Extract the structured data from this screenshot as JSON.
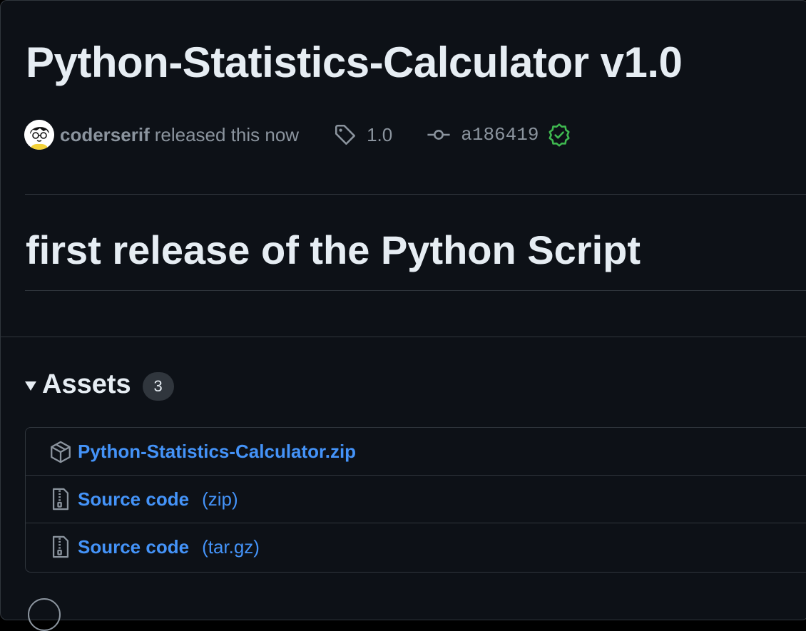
{
  "release": {
    "title": "Python-Statistics-Calculator v1.0",
    "author": "coderserif",
    "released_text": "released this now",
    "tag": "1.0",
    "commit": "a186419",
    "body_heading": "first release of the Python Script"
  },
  "assets": {
    "title": "Assets",
    "count": "3",
    "items": [
      {
        "name": "Python-Statistics-Calculator.zip",
        "suffix": "",
        "icon": "package-icon"
      },
      {
        "name": "Source code",
        "suffix": "(zip)",
        "icon": "file-zip-icon"
      },
      {
        "name": "Source code",
        "suffix": "(tar.gz)",
        "icon": "file-zip-icon"
      }
    ]
  },
  "icons": {
    "tag": "tag-icon",
    "commit": "git-commit-icon",
    "verified": "verified-icon",
    "reaction": "smiley-icon"
  },
  "colors": {
    "background": "#0d1117",
    "border": "#30363d",
    "text": "#e6edf3",
    "muted": "#8b949e",
    "link": "#4493f8",
    "verified": "#3fb950"
  }
}
